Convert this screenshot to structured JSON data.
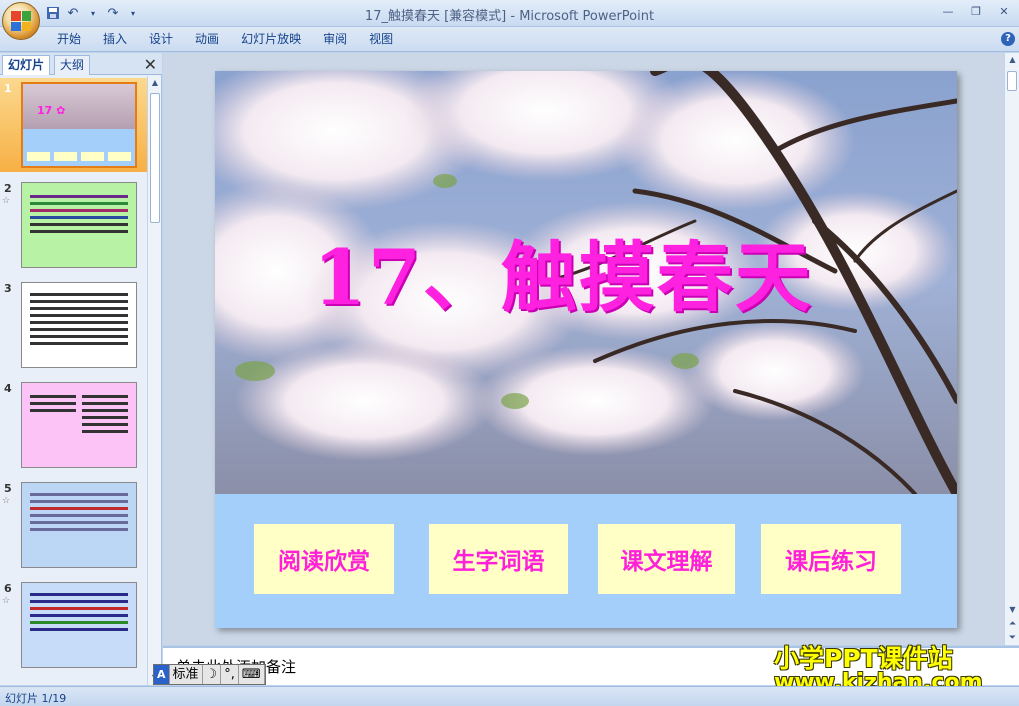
{
  "window": {
    "title": "17_触摸春天 [兼容模式] - Microsoft PowerPoint",
    "qat": [
      "save-icon",
      "undo-icon",
      "redo-icon",
      "customize-icon"
    ],
    "controls": [
      "minimize-icon",
      "restore-icon",
      "close-icon"
    ]
  },
  "ribbon": {
    "tabs": [
      "开始",
      "插入",
      "设计",
      "动画",
      "幻灯片放映",
      "审阅",
      "视图"
    ]
  },
  "left_panel": {
    "tabs": {
      "slides": "幻灯片",
      "outline": "大纲"
    },
    "thumbnails": [
      {
        "num": "1",
        "selected": true,
        "bg": "#f0a0c0"
      },
      {
        "num": "2",
        "selected": false,
        "bg": "#b8f2a5"
      },
      {
        "num": "3",
        "selected": false,
        "bg": "#ffffff"
      },
      {
        "num": "4",
        "selected": false,
        "bg": "#fcc4f6"
      },
      {
        "num": "5",
        "selected": false,
        "bg": "#bcd6f5"
      },
      {
        "num": "6",
        "selected": false,
        "bg": "#c6dcf8"
      }
    ]
  },
  "slide": {
    "title": "17、触摸春天",
    "buttons": [
      "阅读欣赏",
      "生字词语",
      "课文理解",
      "课后练习"
    ],
    "colors": {
      "title": "#ff21e0",
      "band": "#a4cffa",
      "button_bg": "#ffffc6"
    }
  },
  "notes": {
    "placeholder": "单击此处添加备注"
  },
  "ime": {
    "logo": "A",
    "mode": "标准",
    "moon": "☽",
    "punct": "°,",
    "keyboard": "⌨"
  },
  "watermark": {
    "line1": "小学PPT课件站",
    "line2": "www.kjzhan.com"
  },
  "status": {
    "slide_counter": "幻灯片 1/19"
  }
}
